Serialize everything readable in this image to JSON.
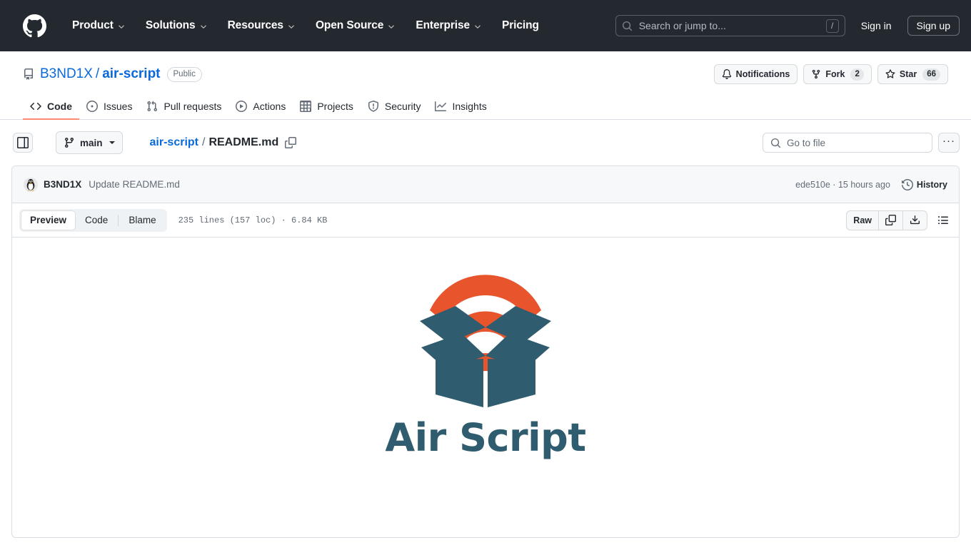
{
  "global_header": {
    "logo_icon": "github-mark-icon",
    "nav": [
      {
        "label": "Product",
        "has_dropdown": true
      },
      {
        "label": "Solutions",
        "has_dropdown": true
      },
      {
        "label": "Resources",
        "has_dropdown": true
      },
      {
        "label": "Open Source",
        "has_dropdown": true
      },
      {
        "label": "Enterprise",
        "has_dropdown": true
      },
      {
        "label": "Pricing",
        "has_dropdown": false
      }
    ],
    "search": {
      "placeholder": "Search or jump to...",
      "shortcut": "/",
      "icon": "search-icon"
    },
    "sign_in": "Sign in",
    "sign_up": "Sign up",
    "background_color": "#24292f"
  },
  "repository": {
    "icon": "repo-icon",
    "owner": "B3ND1X",
    "separator": "/",
    "name": "air-script",
    "visibility": "Public",
    "actions": [
      {
        "label": "Notifications",
        "icon": "bell-icon",
        "count": null
      },
      {
        "label": "Fork",
        "icon": "fork-icon",
        "count": "2"
      },
      {
        "label": "Star",
        "icon": "star-icon",
        "count": "66"
      }
    ],
    "tabs": [
      {
        "label": "Code",
        "icon": "code-icon",
        "active": true
      },
      {
        "label": "Issues",
        "icon": "issue-opened-icon",
        "active": false
      },
      {
        "label": "Pull requests",
        "icon": "git-pull-request-icon",
        "active": false
      },
      {
        "label": "Actions",
        "icon": "play-icon",
        "active": false
      },
      {
        "label": "Projects",
        "icon": "table-icon",
        "active": false
      },
      {
        "label": "Security",
        "icon": "shield-icon",
        "active": false
      },
      {
        "label": "Insights",
        "icon": "graph-icon",
        "active": false
      }
    ],
    "active_tab_underline_color": "#fd8c73"
  },
  "file_nav": {
    "sidebar_toggle_icon": "sidebar-expand-icon",
    "branch": {
      "name": "main",
      "icon": "git-branch-icon"
    },
    "breadcrumb": {
      "repo_link": "air-script",
      "separator": "/",
      "file": "README.md",
      "copy_icon": "copy-path-icon"
    },
    "go_to_file": {
      "placeholder": "Go to file",
      "icon": "search-icon"
    },
    "more_options": "···"
  },
  "commit": {
    "avatar_icon": "penguin-avatar",
    "author": "B3ND1X",
    "message": "Update README.md",
    "hash": "ede510e",
    "meta_separator": "·",
    "relative_time": "15 hours ago",
    "history_label": "History",
    "history_icon": "history-icon"
  },
  "file_toolbar": {
    "view_tabs": [
      {
        "label": "Preview",
        "active": true
      },
      {
        "label": "Code",
        "active": false
      },
      {
        "label": "Blame",
        "active": false
      }
    ],
    "file_meta": "235 lines (157 loc) · 6.84 KB",
    "raw_label": "Raw",
    "copy_icon": "copy-icon",
    "download_icon": "download-icon",
    "outline_icon": "outline-list-icon"
  },
  "readme": {
    "logo_alt": "air-script-logo",
    "title": "Air Script",
    "title_color": "#2f5c6e",
    "wifi_color": "#e8542b",
    "box_color": "#2f5c6e"
  }
}
